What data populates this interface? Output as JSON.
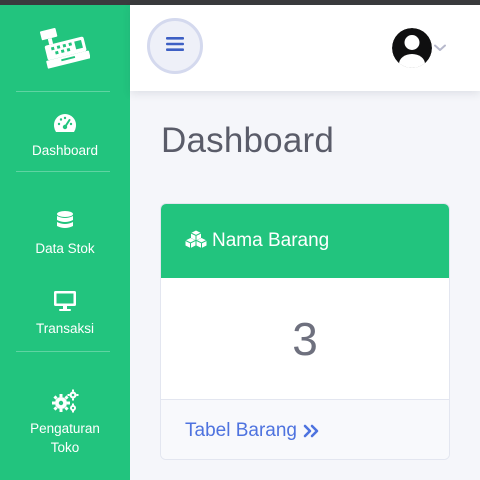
{
  "sidebar": {
    "brand_icon": "cash-register-icon",
    "items": [
      {
        "label": "Dashboard",
        "icon": "tachometer-icon"
      },
      {
        "label": "Data Stok",
        "icon": "database-icon"
      },
      {
        "label": "Transaksi",
        "icon": "desktop-icon"
      },
      {
        "label": "Pengaturan Toko",
        "label_line1": "Pengaturan",
        "label_line2": "Toko",
        "icon": "cogs-icon"
      }
    ]
  },
  "topbar": {
    "toggle_icon": "bars-icon",
    "user_icon": "user-avatar-icon",
    "dropdown_icon": "chevron-down-icon"
  },
  "page": {
    "title": "Dashboard"
  },
  "card": {
    "title": "Nama Barang",
    "title_icon": "cubes-icon",
    "value": "3",
    "link_label": "Tabel Barang",
    "link_icon": "angle-double-right-icon"
  },
  "colors": {
    "primary_green": "#22c47e",
    "link_blue": "#4e73df",
    "text_gray": "#5a5c69"
  }
}
